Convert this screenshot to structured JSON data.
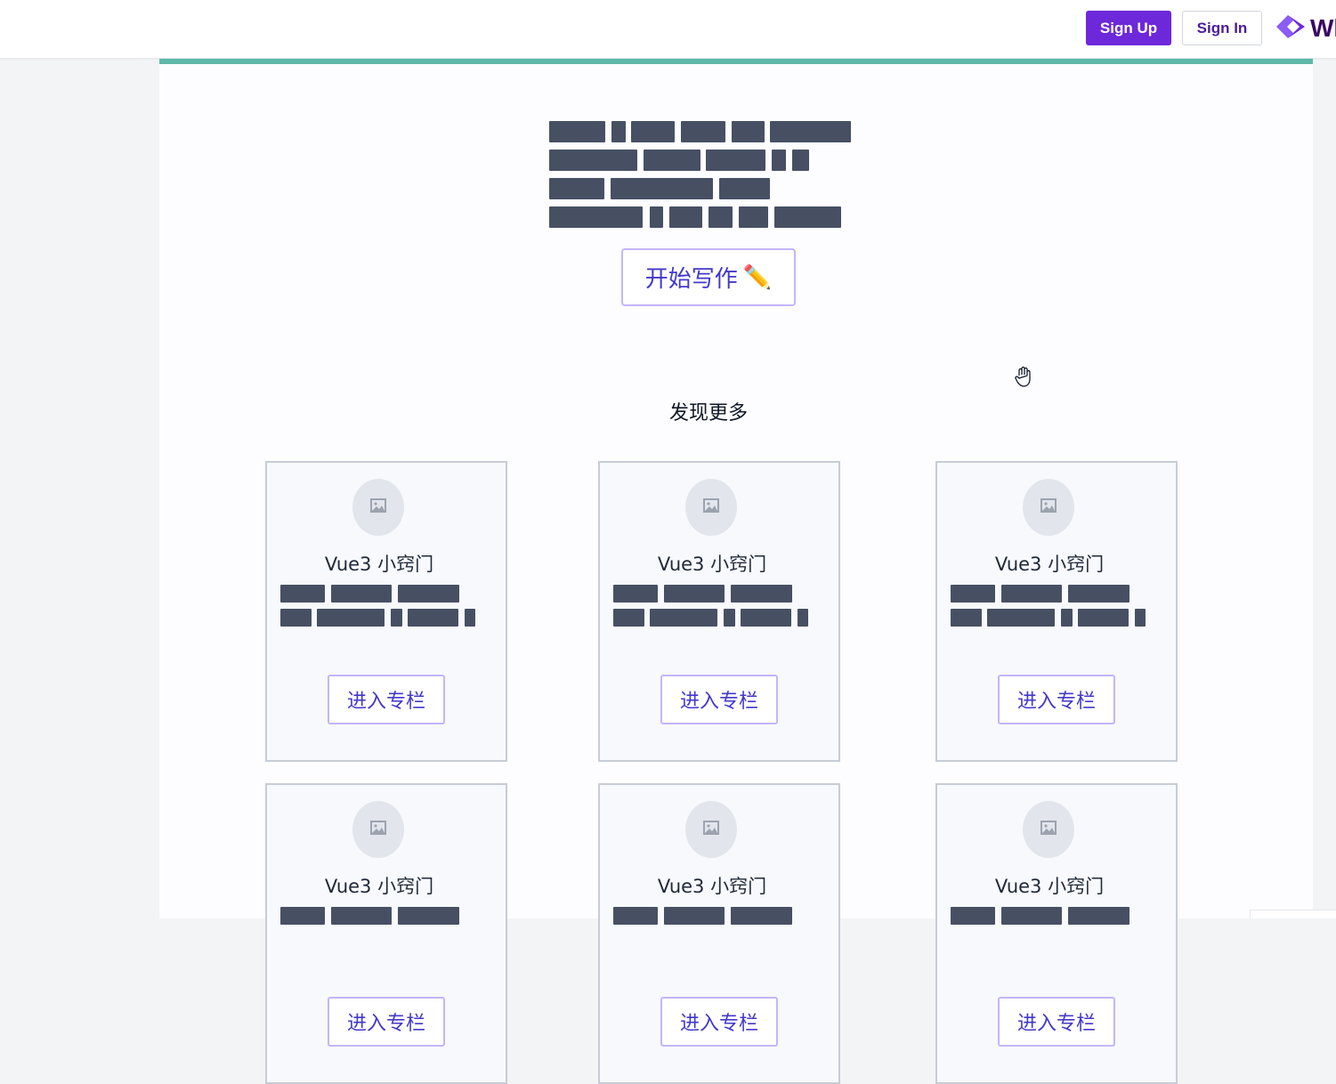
{
  "header": {
    "signup_label": "Sign Up",
    "signin_label": "Sign In",
    "brand_text": "Wh",
    "brand_icon": "diamond-logo-icon",
    "accent_color": "#6d28d9"
  },
  "hero": {
    "write_button_label": "开始写作",
    "write_button_icon": "✏️"
  },
  "discover": {
    "heading": "发现更多",
    "columns": [
      {
        "title": "Vue3 小窍门",
        "enter_label": "进入专栏"
      },
      {
        "title": "Vue3 小窍门",
        "enter_label": "进入专栏"
      },
      {
        "title": "Vue3 小窍门",
        "enter_label": "进入专栏"
      },
      {
        "title": "Vue3 小窍门",
        "enter_label": "进入专栏"
      },
      {
        "title": "Vue3 小窍门",
        "enter_label": "进入专栏"
      },
      {
        "title": "Vue3 小窍门",
        "enter_label": "进入专栏"
      }
    ]
  },
  "icons": {
    "avatar_placeholder": "image-placeholder-icon",
    "cursor": "grab-hand-cursor-icon"
  }
}
